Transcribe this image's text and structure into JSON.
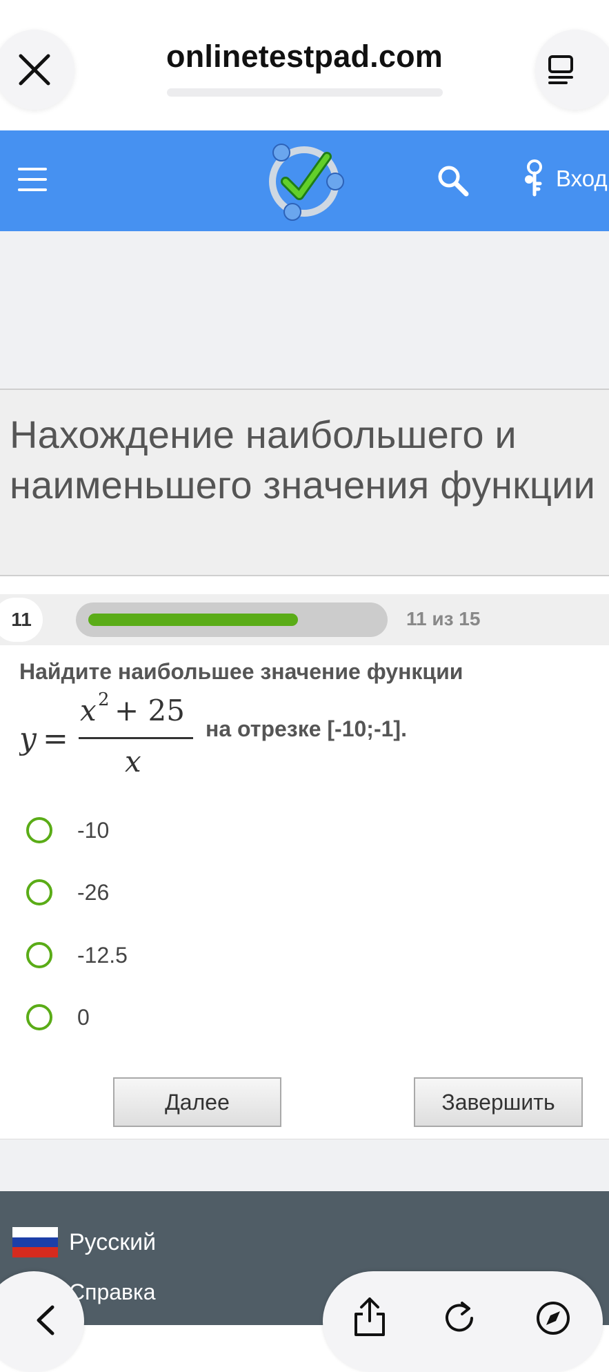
{
  "browser": {
    "url": "onlinetestpad.com"
  },
  "header": {
    "login_label": "Вход"
  },
  "test": {
    "title": "Нахождение наибольшего и наименьшего значения функции"
  },
  "progress": {
    "question_number": "11",
    "count_text": "11 из 15",
    "fraction": 0.73
  },
  "question": {
    "prompt": "Найдите наибольшее значение функции",
    "interval_text": "на отрезке [-10;-1]."
  },
  "options": [
    {
      "label": "-10"
    },
    {
      "label": "-26"
    },
    {
      "label": "-12.5"
    },
    {
      "label": "0"
    }
  ],
  "buttons": {
    "next_label": "Далее",
    "finish_label": "Завершить"
  },
  "footer": {
    "language_label": "Русский",
    "help_label": "Справка"
  },
  "colors": {
    "header_blue": "#4691f1",
    "accent_green": "#5aac17",
    "footer_grey": "#505d66"
  },
  "icons": [
    "close-icon",
    "tabs-icon",
    "menu-icon",
    "logo-icon",
    "search-icon",
    "key-icon",
    "flag-icon",
    "back-icon",
    "share-icon",
    "reload-icon",
    "compass-icon"
  ]
}
